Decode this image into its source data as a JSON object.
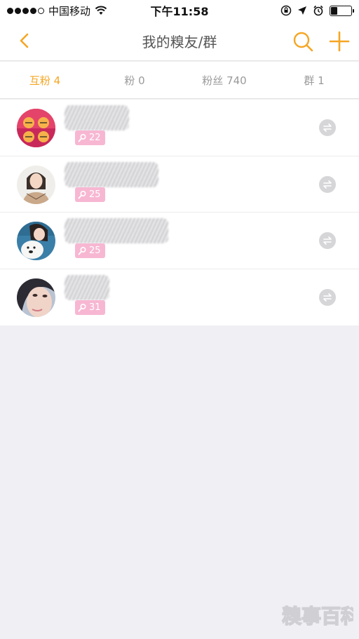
{
  "status_bar": {
    "carrier": "中国移动",
    "time": "下午11:58"
  },
  "nav": {
    "title": "我的糗友/群",
    "back_icon": "chevron-left-icon",
    "search_icon": "search-icon",
    "add_icon": "plus-icon",
    "accent_color": "#f5a623"
  },
  "tabs": [
    {
      "label": "互粉 4",
      "active": true
    },
    {
      "label": "粉 0",
      "active": false
    },
    {
      "label": "粉丝 740",
      "active": false
    },
    {
      "label": "群 1",
      "active": false
    }
  ],
  "friends": [
    {
      "level": "22",
      "avatar": "cat-face-avatar"
    },
    {
      "level": "25",
      "avatar": "girl-avatar"
    },
    {
      "level": "25",
      "avatar": "girl-with-dog-avatar"
    },
    {
      "level": "31",
      "avatar": "girl-closeup-avatar"
    }
  ],
  "watermark": "糗事百科",
  "colors": {
    "badge": "#f7b7d2",
    "toggle": "#d6d6d9",
    "background": "#f0f0f4"
  }
}
